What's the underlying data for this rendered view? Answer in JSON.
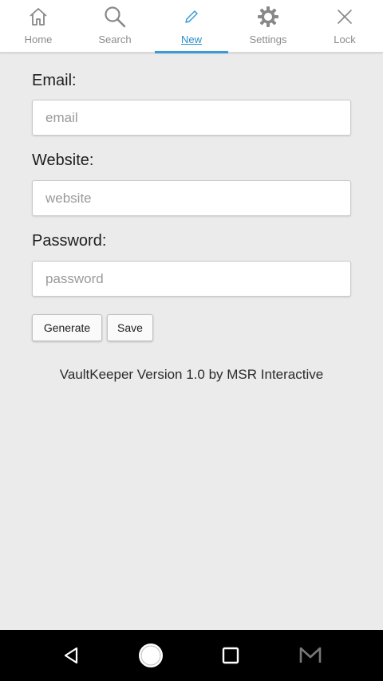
{
  "tabs": [
    {
      "label": "Home",
      "icon": "home-icon",
      "active": false
    },
    {
      "label": "Search",
      "icon": "search-icon",
      "active": false
    },
    {
      "label": "New",
      "icon": "pencil-icon",
      "active": true
    },
    {
      "label": "Settings",
      "icon": "gear-icon",
      "active": false
    },
    {
      "label": "Lock",
      "icon": "close-icon",
      "active": false
    }
  ],
  "form": {
    "email_label": "Email:",
    "email_placeholder": "email",
    "email_value": "",
    "website_label": "Website:",
    "website_placeholder": "website",
    "website_value": "",
    "password_label": "Password:",
    "password_placeholder": "password",
    "password_value": ""
  },
  "buttons": {
    "generate": "Generate",
    "save": "Save"
  },
  "footer_text": "VaultKeeper Version 1.0 by MSR Interactive",
  "colors": {
    "accent": "#3a9bd5",
    "background": "#ebebeb",
    "tabbar": "#ffffff",
    "navbar": "#000000"
  },
  "system_nav": [
    "back-icon",
    "home-circle-icon",
    "recents-icon",
    "gmail-icon"
  ]
}
